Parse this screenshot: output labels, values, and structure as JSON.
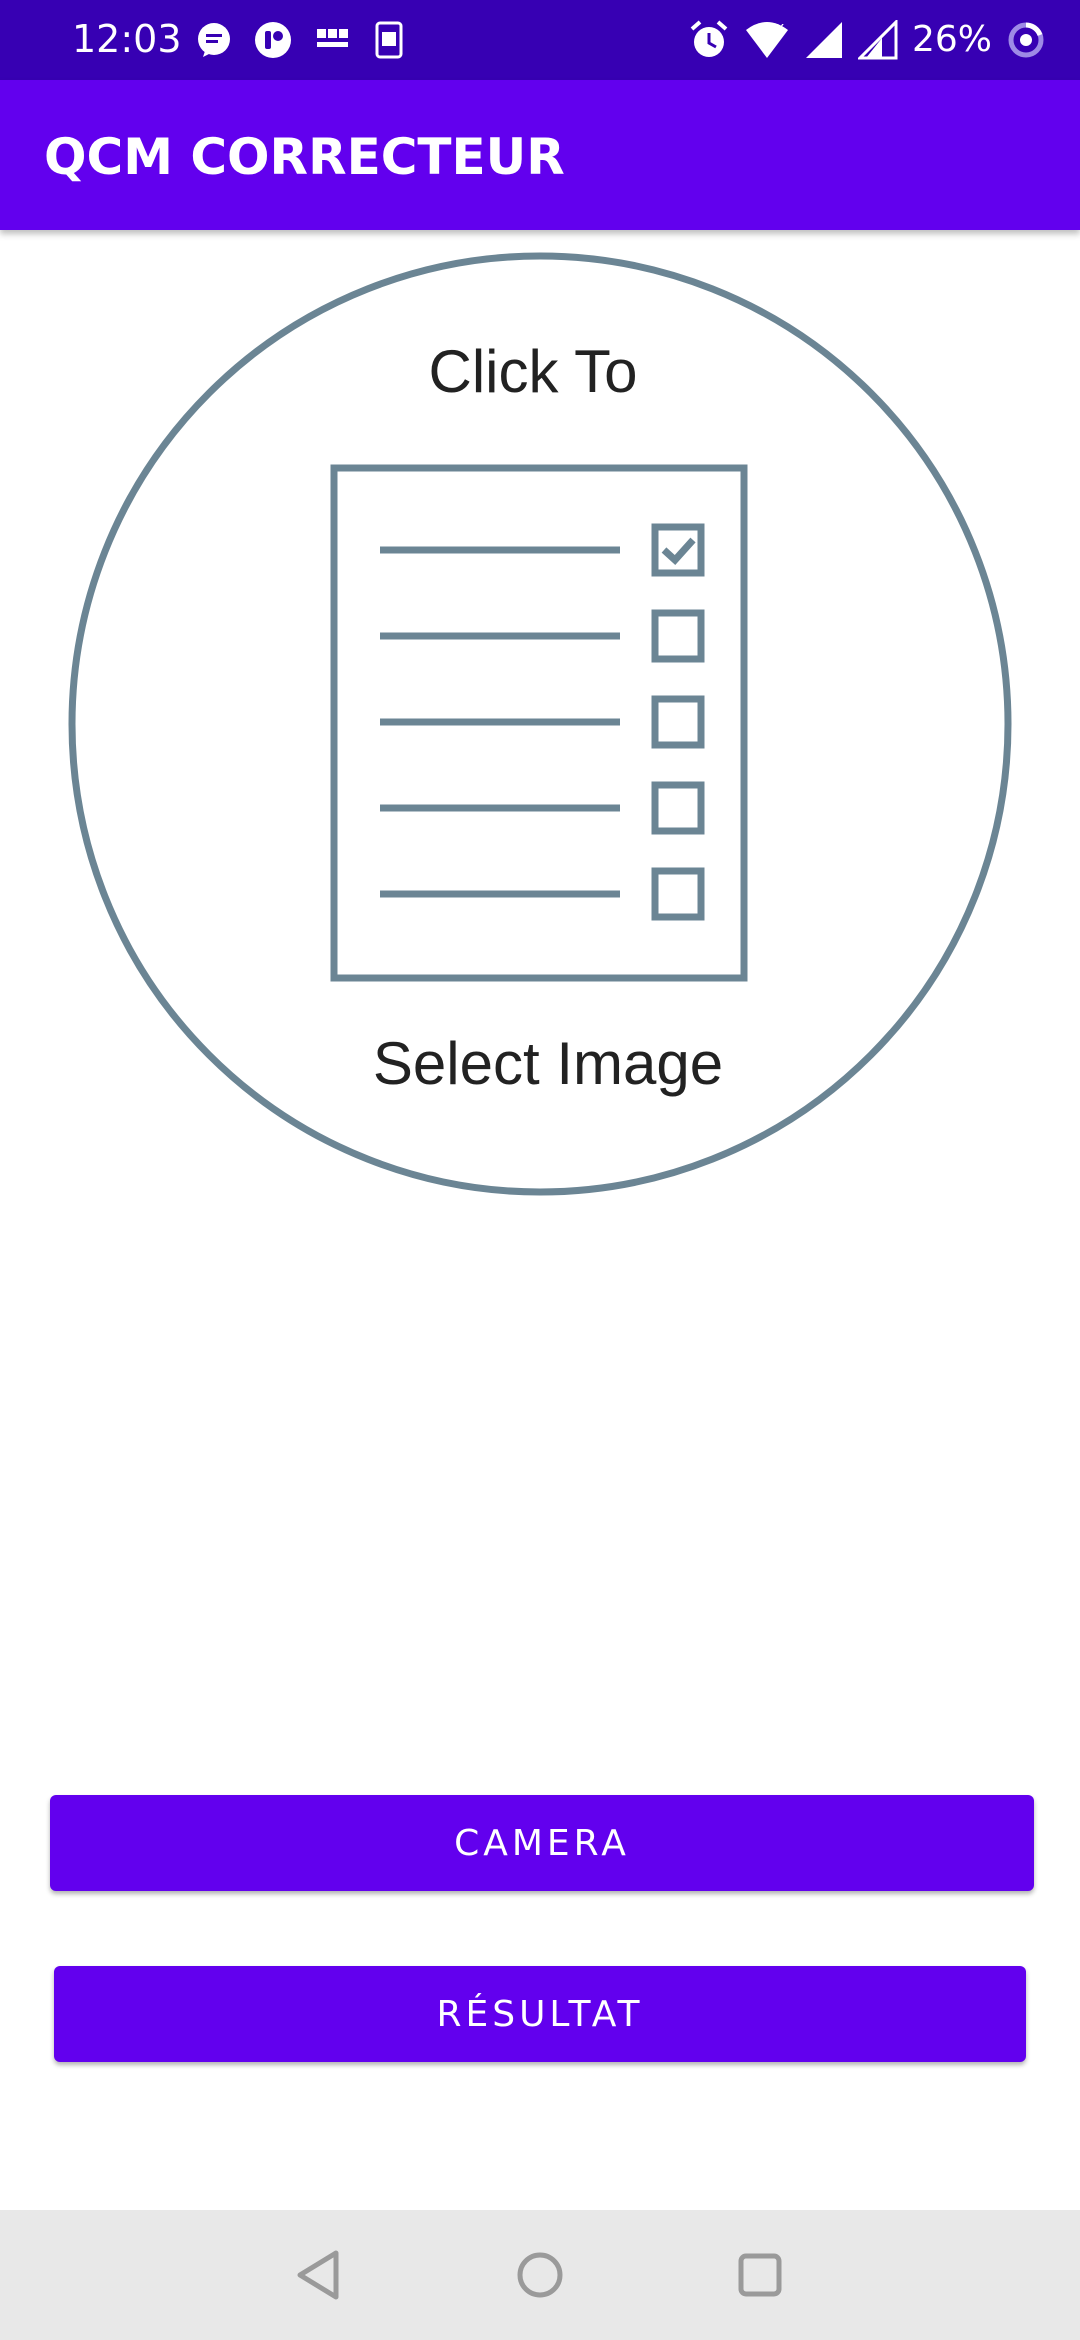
{
  "status_bar": {
    "time": "12:03",
    "battery": "26%",
    "left_icons": [
      "messaging-icon",
      "app-notification-icon",
      "bbc-news-icon",
      "contact-card-icon"
    ],
    "right_icons": [
      "alarm-icon",
      "wifi-icon",
      "signal-icon",
      "signal-icon-2",
      "battery-ring-icon"
    ]
  },
  "app_bar": {
    "title": "QCM CORRECTEUR"
  },
  "image_select": {
    "top_text": "Click To",
    "bottom_text": "Select Image",
    "checked_rows": 1,
    "total_rows": 5,
    "color": "#6b8594"
  },
  "buttons": {
    "camera": "CAMERA",
    "result": "RÉSULTAT"
  },
  "colors": {
    "primary": "#6200ee",
    "primary_dark": "#3700b3",
    "nav_bar": "#e8e8e8"
  },
  "nav_bar": {
    "icons": [
      "back-icon",
      "home-icon",
      "recents-icon"
    ]
  }
}
